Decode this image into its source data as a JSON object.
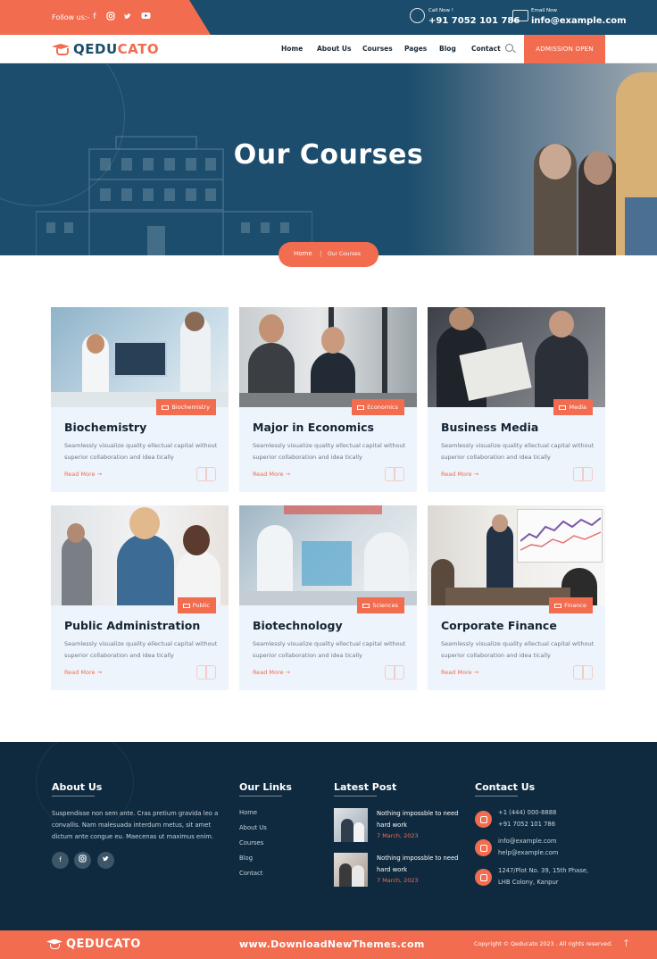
{
  "topbar": {
    "follow_label": "Follow us:-",
    "call_label": "Call Now !",
    "phone": "+91 7052 101 786",
    "email_label": "Email Now",
    "email": "info@example.com"
  },
  "nav": {
    "logo_q": "Q",
    "logo_rest_dark": "EDU",
    "logo_rest_orange": "CATO",
    "items": [
      "Home",
      "About Us",
      "Courses",
      "Pages",
      "Blog",
      "Contact"
    ],
    "admission": "ADMISSION OPEN"
  },
  "hero": {
    "title": "Our Courses",
    "breadcrumb_home": "Home",
    "breadcrumb_sep": "|",
    "breadcrumb_current": "Our Courses"
  },
  "courses": [
    {
      "title": "Biochemistry",
      "tag": "Biochemistry",
      "desc": "Seamlessly visualize quality ellectual capital without superior collaboration and idea tically",
      "more": "Read More"
    },
    {
      "title": "Major in Economics",
      "tag": "Economics",
      "desc": "Seamlessly visualize quality ellectual capital without superior collaboration and idea tically",
      "more": "Read More"
    },
    {
      "title": "Business Media",
      "tag": "Media",
      "desc": "Seamlessly visualize quality ellectual capital without superior collaboration and idea tically",
      "more": "Read More"
    },
    {
      "title": "Public Administration",
      "tag": "Public",
      "desc": "Seamlessly visualize quality ellectual capital without superior collaboration and idea tically",
      "more": "Read More"
    },
    {
      "title": "Biotechnology",
      "tag": "Sciences",
      "desc": "Seamlessly visualize quality ellectual capital without superior collaboration and idea tically",
      "more": "Read More"
    },
    {
      "title": "Corporate Finance",
      "tag": "Finance",
      "desc": "Seamlessly visualize quality ellectual capital without superior collaboration and idea tically",
      "more": "Read More"
    }
  ],
  "footer": {
    "about_heading": "About Us",
    "about_text": "Suspendisse non sem ante. Cras pretium gravida leo a convallis. Nam malesuada interdum metus, sit amet dictum ante congue eu. Maecenas ut maximus enim.",
    "links_heading": "Our Links",
    "links": [
      "Home",
      "About Us",
      "Courses",
      "Blog",
      "Contact"
    ],
    "posts_heading": "Latest Post",
    "posts": [
      {
        "title": "Nothing impossble to need hard work",
        "date": "7 March, 2023"
      },
      {
        "title": "Nothing impossble to need hard work",
        "date": "7 March, 2023"
      }
    ],
    "contact_heading": "Contact Us",
    "contact": {
      "phone1": "+1 (444) 000-8888",
      "phone2": "+91 7052 101 786",
      "email1": "info@example.com",
      "email2": "help@example.com",
      "address1": "1247/Plot No. 39, 15th Phase,",
      "address2": "LHB Colony, Kanpur"
    }
  },
  "bottom": {
    "logo": "QEDUCATO",
    "watermark": "www.DownloadNewThemes.com",
    "copyright": "Copyright © Qeducato 2023 . All rights reserved."
  },
  "colors": {
    "accent": "#f26c4f",
    "primary_dark": "#1c4c6b",
    "footer_bg": "#0f2a3f",
    "card_bg": "#eef4fb"
  }
}
